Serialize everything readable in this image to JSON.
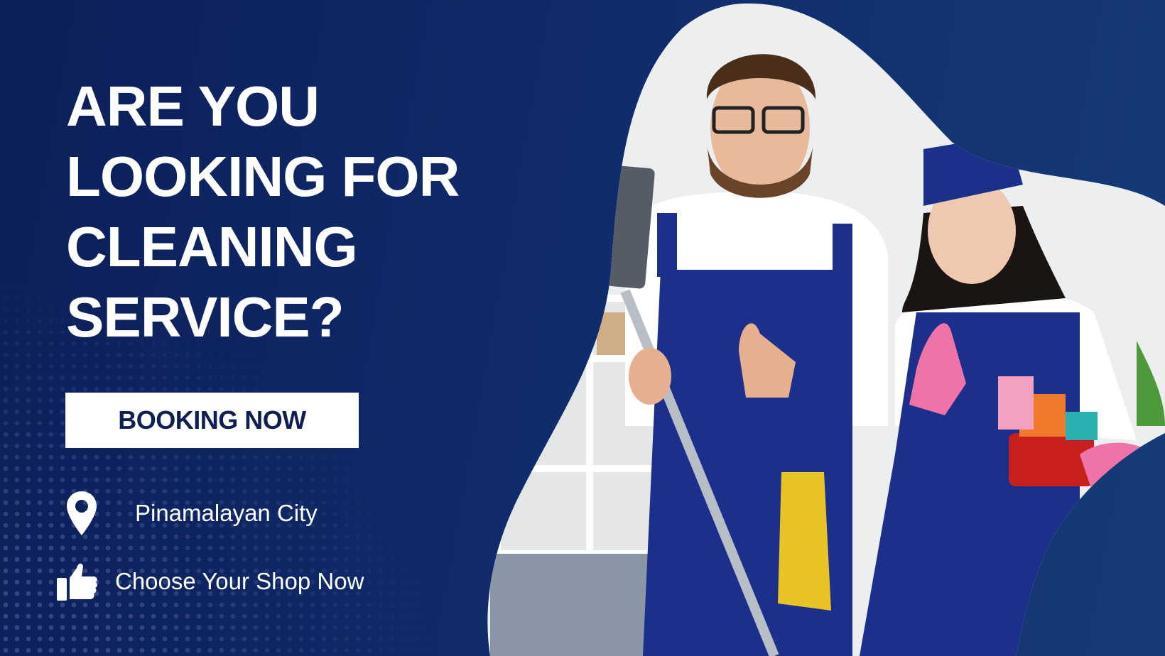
{
  "headline": [
    "ARE YOU",
    "LOOKING FOR",
    "CLEANING",
    "SERVICE?"
  ],
  "cta_label": "BOOKING NOW",
  "info": [
    {
      "icon": "map-pin-icon",
      "text": "Pinamalayan City"
    },
    {
      "icon": "thumbs-up-icon",
      "text": "Choose Your Shop Now"
    }
  ],
  "colors": {
    "background": "#102a6a",
    "button_text": "#0f1f55",
    "apron": "#1c2f8a"
  }
}
